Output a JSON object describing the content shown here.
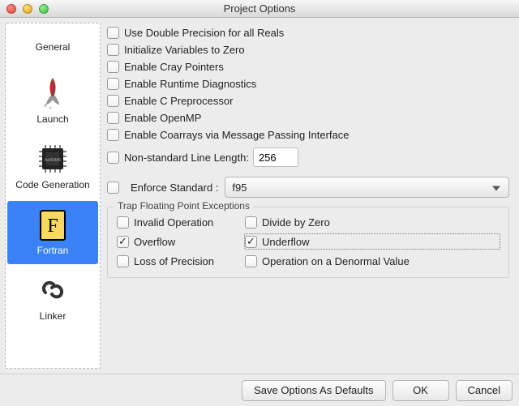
{
  "window": {
    "title": "Project Options"
  },
  "sidebar": {
    "items": [
      {
        "id": "general",
        "label": "General"
      },
      {
        "id": "launch",
        "label": "Launch"
      },
      {
        "id": "codegen",
        "label": "Code Generation"
      },
      {
        "id": "fortran",
        "label": "Fortran"
      },
      {
        "id": "linker",
        "label": "Linker"
      }
    ]
  },
  "checks": {
    "double_precision": "Use Double Precision for all Reals",
    "init_zero": "Initialize Variables to Zero",
    "cray_ptr": "Enable Cray Pointers",
    "runtime_diag": "Enable Runtime Diagnostics",
    "c_prep": "Enable C Preprocessor",
    "openmp": "Enable OpenMP",
    "coarrays": "Enable Coarrays via Message Passing Interface",
    "nonstd_len": "Non-standard Line Length:"
  },
  "nonstd_value": "256",
  "enforce": {
    "label": "Enforce Standard :",
    "value": "f95"
  },
  "trap": {
    "title": "Trap Floating Point Exceptions",
    "invalid": "Invalid Operation",
    "divzero": "Divide by Zero",
    "overflow": "Overflow",
    "underflow": "Underflow",
    "loss": "Loss of Precision",
    "denorm": "Operation on a Denormal Value"
  },
  "buttons": {
    "save_defaults": "Save Options As Defaults",
    "ok": "OK",
    "cancel": "Cancel"
  }
}
